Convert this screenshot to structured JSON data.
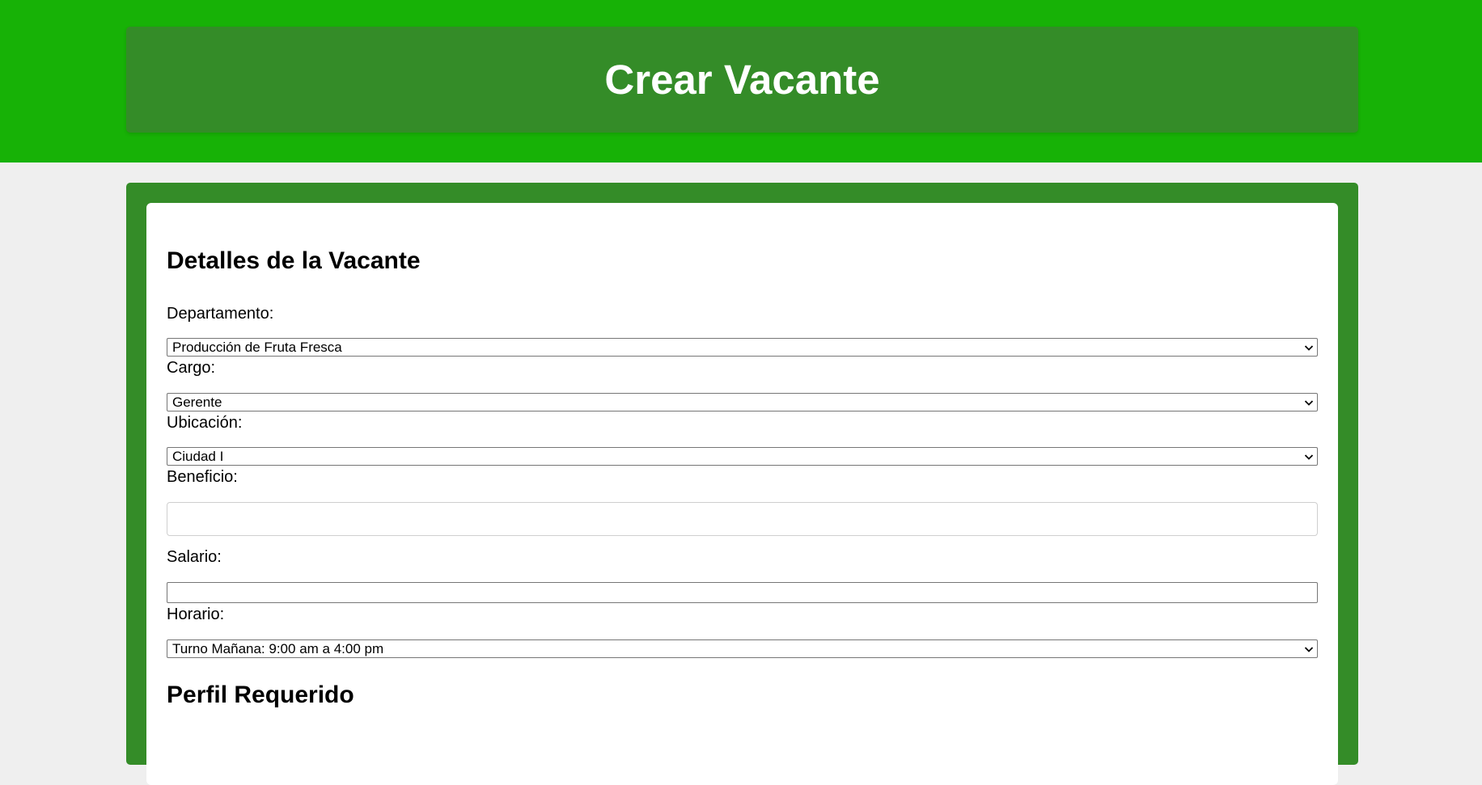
{
  "header": {
    "title": "Crear Vacante"
  },
  "form": {
    "section_details": "Detalles de la Vacante",
    "departamento": {
      "label": "Departamento:",
      "selected": "Producción de Fruta Fresca"
    },
    "cargo": {
      "label": "Cargo:",
      "selected": "Gerente"
    },
    "ubicacion": {
      "label": "Ubicación:",
      "selected": "Ciudad I"
    },
    "beneficio": {
      "label": "Beneficio:",
      "value": ""
    },
    "salario": {
      "label": "Salario:",
      "value": ""
    },
    "horario": {
      "label": "Horario:",
      "selected": "Turno Mañana: 9:00 am a 4:00 pm"
    },
    "section_profile": "Perfil Requerido"
  },
  "colors": {
    "top_band": "#17b206",
    "header_box": "#348c28",
    "card_frame": "#348c28",
    "page_bg": "#efefef"
  },
  "icons": {
    "select_arrow": "chevron-down-icon"
  }
}
